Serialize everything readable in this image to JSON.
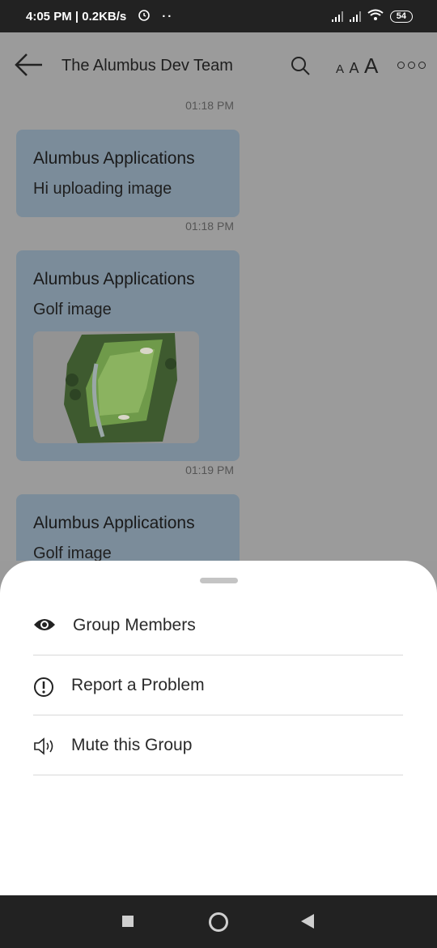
{
  "status": {
    "time": "4:05 PM | 0.2KB/s",
    "battery": "54",
    "dots": "··"
  },
  "header": {
    "title": "The Alumbus Dev Team",
    "font_small": "A",
    "font_medium": "A",
    "font_large": "A"
  },
  "messages": [
    {
      "timestamp": "01:18 PM"
    },
    {
      "sender": "Alumbus Applications",
      "text": "Hi uploading image",
      "timestamp": "01:18 PM"
    },
    {
      "sender": "Alumbus Applications",
      "text": "Golf image",
      "timestamp": "01:19 PM",
      "has_image": true
    },
    {
      "sender": "Alumbus Applications",
      "text": "Golf image"
    }
  ],
  "sheet": {
    "items": [
      {
        "label": "Group Members",
        "icon": "eye-icon"
      },
      {
        "label": "Report a Problem",
        "icon": "exclamation-circle-icon"
      },
      {
        "label": "Mute this Group",
        "icon": "speaker-icon"
      }
    ]
  },
  "colors": {
    "overlay": "#9b9b9b",
    "bubble": "#7b8c9a",
    "sheet": "#ffffff",
    "bars": "#222222"
  }
}
